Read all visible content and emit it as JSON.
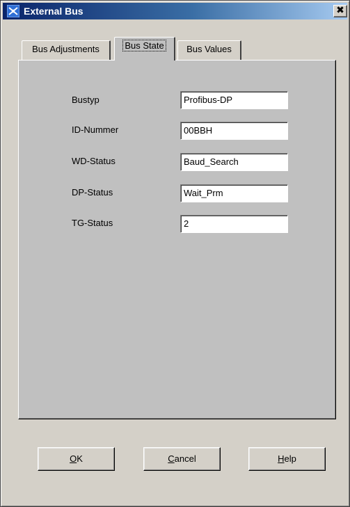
{
  "window": {
    "title": "External Bus",
    "app_icon": "app-icon",
    "close_glyph": "✖"
  },
  "tabs": [
    {
      "label": "Bus Adjustments",
      "active": false
    },
    {
      "label": "Bus State",
      "active": true
    },
    {
      "label": "Bus Values",
      "active": false
    }
  ],
  "fields": [
    {
      "label": "Bustyp",
      "value": "Profibus-DP"
    },
    {
      "label": "ID-Nummer",
      "value": "00BBH"
    },
    {
      "label": "WD-Status",
      "value": "Baud_Search"
    },
    {
      "label": "DP-Status",
      "value": "Wait_Prm"
    },
    {
      "label": "TG-Status",
      "value": "2"
    }
  ],
  "buttons": {
    "ok": {
      "mnemonic": "O",
      "rest": "K"
    },
    "cancel": {
      "mnemonic": "C",
      "rest": "ancel"
    },
    "help": {
      "mnemonic": "H",
      "rest": "elp"
    }
  },
  "colors": {
    "title_start": "#0a246a",
    "title_end": "#a6caf0",
    "dialog_bg": "#d4d0c8",
    "panel_bg": "#c0c0c0"
  }
}
